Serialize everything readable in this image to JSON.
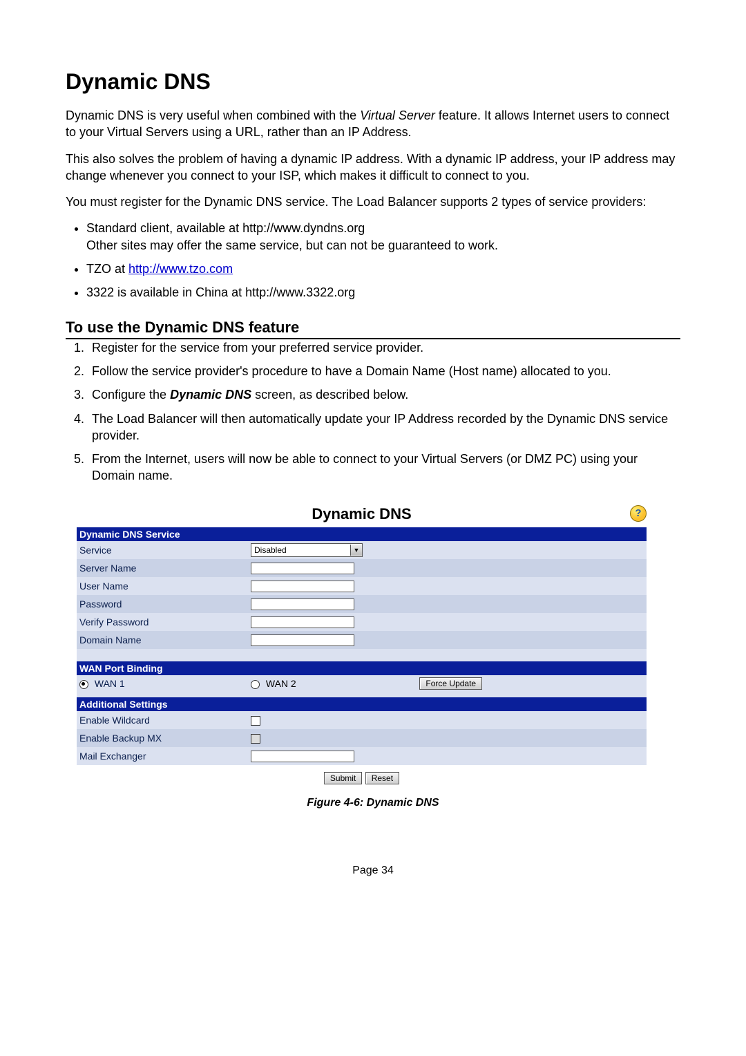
{
  "heading": "Dynamic DNS",
  "para1_a": "Dynamic DNS is very useful when combined with the ",
  "para1_italic": "Virtual Server",
  "para1_b": " feature. It allows Internet users to connect to your Virtual Servers using a URL, rather than an IP Address.",
  "para2": "This also solves the problem of having a dynamic IP address. With a dynamic IP address, your IP address may change whenever you connect to your ISP, which makes it difficult to connect to you.",
  "para3": "You must register for the Dynamic DNS service. The Load Balancer supports 2 types of service providers:",
  "bullets": {
    "b1_line1": "Standard client, available at http://www.dyndns.org",
    "b1_line2": "Other sites may offer the same service, but can not be guaranteed to work.",
    "b2_prefix": "TZO at ",
    "b2_link": "http://www.tzo.com",
    "b3": "3322 is available in China at http://www.3322.org"
  },
  "subheading": "To use the Dynamic DNS feature",
  "steps": {
    "s1": "Register for the service from your preferred service provider.",
    "s2": "Follow the service provider's procedure to have a Domain Name (Host name) allocated to you.",
    "s3_a": "Configure the ",
    "s3_bold": "Dynamic DNS",
    "s3_b": " screen, as described below.",
    "s4": "The Load Balancer will then automatically update your IP Address recorded by the Dynamic DNS service provider.",
    "s5": "From the Internet, users will now be able to connect to your Virtual Servers (or DMZ PC) using your Domain name."
  },
  "panel": {
    "title": "Dynamic DNS",
    "help": "?",
    "sections": {
      "ddns_service": "Dynamic DNS Service",
      "wan_binding": "WAN Port Binding",
      "additional": "Additional Settings"
    },
    "labels": {
      "service": "Service",
      "server_name": "Server Name",
      "user_name": "User Name",
      "password": "Password",
      "verify_password": "Verify Password",
      "domain_name": "Domain Name",
      "wan1": "WAN 1",
      "wan2": "WAN 2",
      "force_update": "Force Update",
      "enable_wildcard": "Enable Wildcard",
      "enable_backup_mx": "Enable Backup MX",
      "mail_exchanger": "Mail Exchanger",
      "submit": "Submit",
      "reset": "Reset"
    },
    "values": {
      "service_selected": "Disabled"
    }
  },
  "figure_caption": "Figure 4-6: Dynamic DNS",
  "page_number": "Page 34"
}
